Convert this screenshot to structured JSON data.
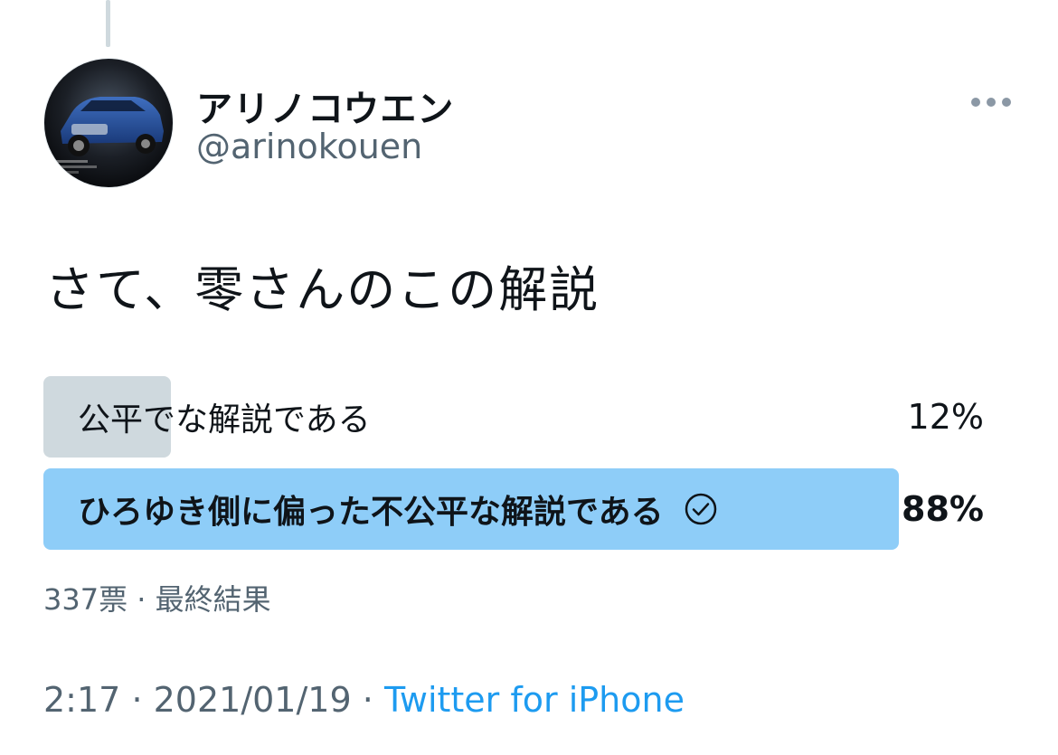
{
  "author": {
    "display_name": "アリノコウエン",
    "handle": "@arinokouen",
    "avatar_icon": "car-avatar-icon"
  },
  "more_icon": "more-horizontal-icon",
  "tweet": {
    "text": "さて、零さんのこの解説"
  },
  "poll": {
    "options": [
      {
        "label": "公平でな解説である",
        "percent_text": "12%",
        "percent": 12,
        "winner": false,
        "bar_color": "#cfd9de"
      },
      {
        "label": "ひろゆき側に偏った不公平な解説である",
        "percent_text": "88%",
        "percent": 88,
        "winner": true,
        "bar_color": "#8ecdf8",
        "check_icon": "check-circle-icon"
      }
    ],
    "votes": "337票",
    "separator": "·",
    "status": "最終結果"
  },
  "meta": {
    "time": "2:17",
    "date": "2021/01/19",
    "separator": "·",
    "source": "Twitter for iPhone",
    "source_color": "#1d9bf0"
  }
}
